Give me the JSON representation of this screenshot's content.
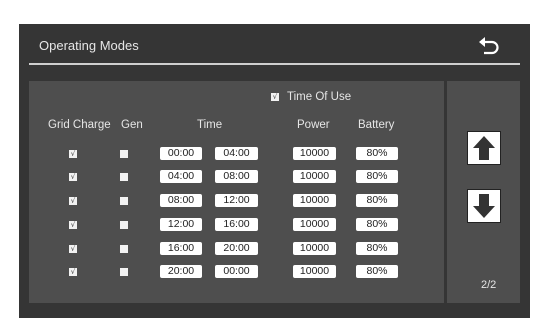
{
  "header": {
    "title": "Operating Modes"
  },
  "time_of_use": {
    "label": "Time Of Use",
    "checked": true,
    "check_glyph": "√"
  },
  "columns": {
    "grid_charge": "Grid Charge",
    "gen": "Gen",
    "time": "Time",
    "power": "Power",
    "battery": "Battery"
  },
  "rows": [
    {
      "grid_charge": "√",
      "gen": "",
      "start": "00:00",
      "end": "04:00",
      "power": "10000",
      "battery": "80%"
    },
    {
      "grid_charge": "√",
      "gen": "",
      "start": "04:00",
      "end": "08:00",
      "power": "10000",
      "battery": "80%"
    },
    {
      "grid_charge": "√",
      "gen": "",
      "start": "08:00",
      "end": "12:00",
      "power": "10000",
      "battery": "80%"
    },
    {
      "grid_charge": "√",
      "gen": "",
      "start": "12:00",
      "end": "16:00",
      "power": "10000",
      "battery": "80%"
    },
    {
      "grid_charge": "√",
      "gen": "",
      "start": "16:00",
      "end": "20:00",
      "power": "10000",
      "battery": "80%"
    },
    {
      "grid_charge": "√",
      "gen": "",
      "start": "20:00",
      "end": "00:00",
      "power": "10000",
      "battery": "80%"
    }
  ],
  "pagination": {
    "label": "2/2"
  },
  "icons": {
    "back": "back-arrow-icon",
    "up": "arrow-up-icon",
    "down": "arrow-down-icon"
  },
  "colors": {
    "background": "#353535",
    "panel": "#4e4e4e",
    "text": "#e6e6e6",
    "field": "#ffffff"
  }
}
